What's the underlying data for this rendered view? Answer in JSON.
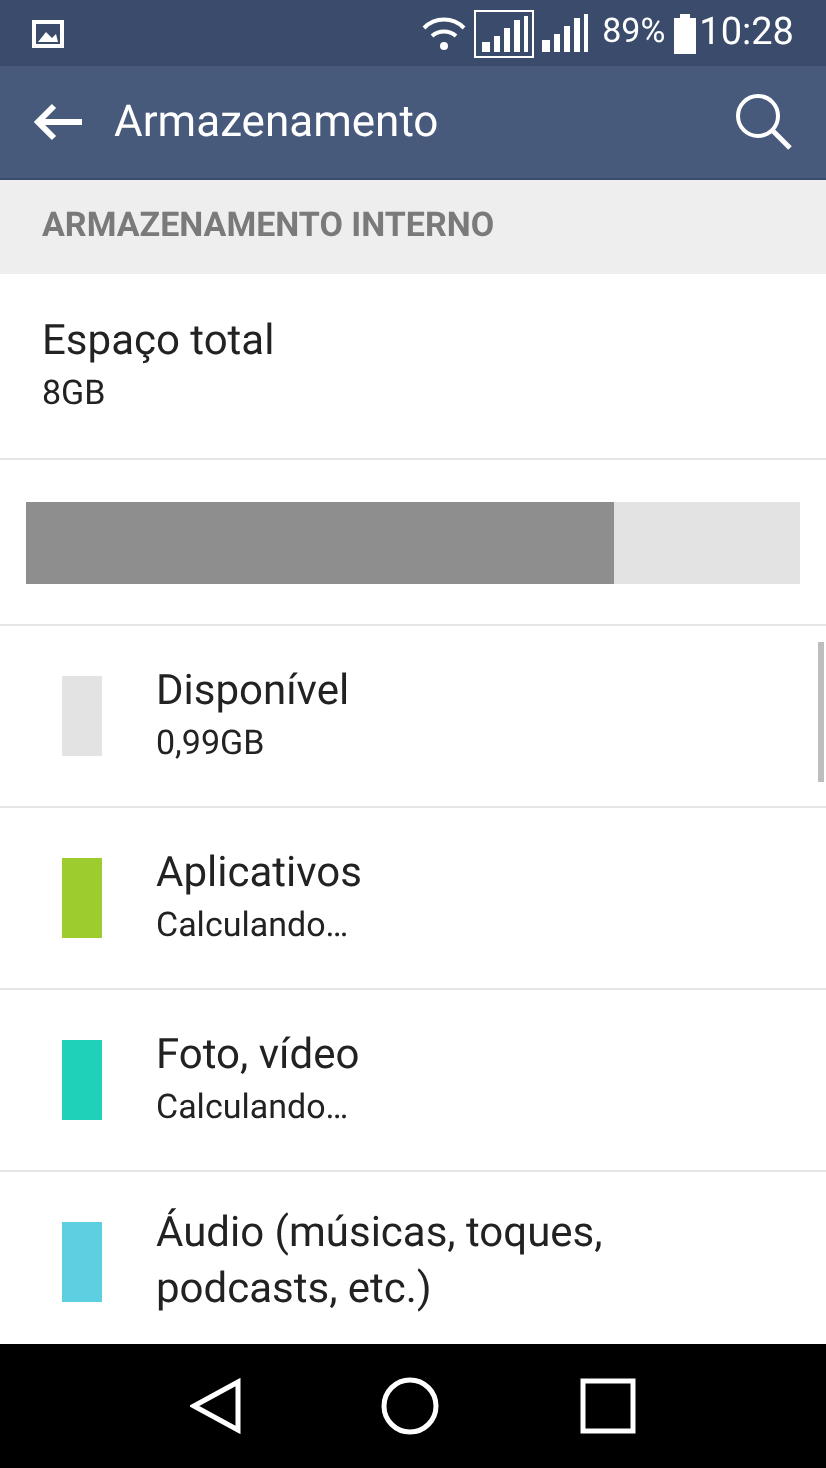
{
  "status_bar": {
    "battery": "89%",
    "time": "10:28"
  },
  "app_bar": {
    "title": "Armazenamento"
  },
  "section": {
    "header": "ARMAZENAMENTO INTERNO"
  },
  "total": {
    "label": "Espaço total",
    "value": "8GB"
  },
  "usage_bar": {
    "level": 0.76
  },
  "categories": [
    {
      "name": "Disponível",
      "value": "0,99GB",
      "color": "#e3e3e3"
    },
    {
      "name": "Aplicativos",
      "value": "Calculando…",
      "color": "#9ccc2e"
    },
    {
      "name": "Foto, vídeo",
      "value": "Calculando…",
      "color": "#1fd1b9"
    },
    {
      "name": "Áudio (músicas, toques, podcasts, etc.)",
      "color": "#5ccfe0"
    }
  ]
}
